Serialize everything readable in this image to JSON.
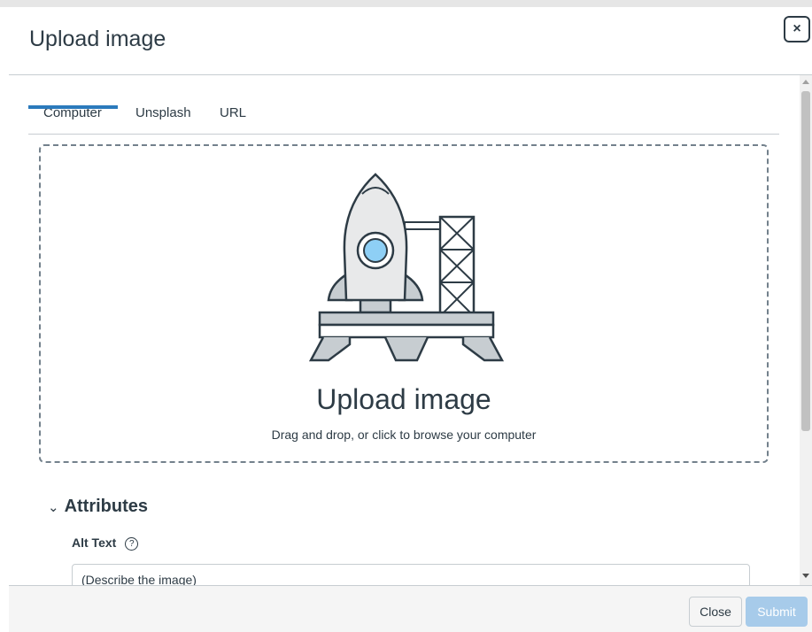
{
  "dialog": {
    "title": "Upload image",
    "close_icon": "×"
  },
  "tabs": [
    {
      "label": "Computer",
      "active": true
    },
    {
      "label": "Unsplash",
      "active": false
    },
    {
      "label": "URL",
      "active": false
    }
  ],
  "dropzone": {
    "illustration": "rocket-launch-icon",
    "title": "Upload image",
    "subtitle": "Drag and drop, or click to browse your computer"
  },
  "attributes": {
    "heading": "Attributes",
    "chevron": "⌄",
    "alt_text_label": "Alt Text",
    "help_glyph": "?",
    "alt_text_placeholder": "(Describe the image)"
  },
  "footer": {
    "close_label": "Close",
    "submit_label": "Submit"
  },
  "colors": {
    "accent": "#2b7abc",
    "submit_disabled": "#a7cbea",
    "text": "#2d3b45",
    "border": "#c7cdd1",
    "rocket_window": "#8ecff5"
  }
}
